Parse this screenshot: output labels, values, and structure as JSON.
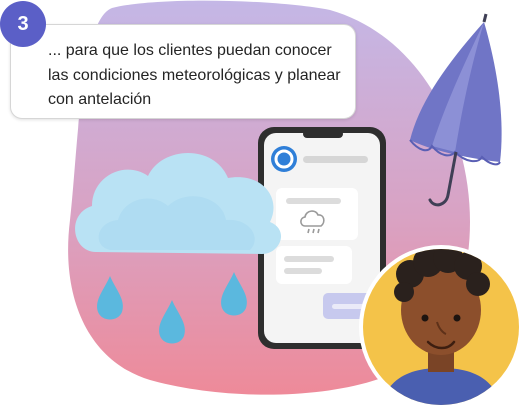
{
  "step": {
    "number": "3",
    "text": "... para que los clientes puedan conocer las condiciones meteorológicas y planear con antelación"
  },
  "colors": {
    "badge": "#5b5fc7",
    "blob_top": "#c4b7e6",
    "blob_bottom": "#ed8c9a",
    "umbrella": "#7075c6",
    "cloud": "#b9e2f4",
    "rain": "#5bb8de",
    "avatar_bg": "#f4c349",
    "phone_frame": "#2e2e2e",
    "phone_button": "#c7c9ee"
  },
  "icons": [
    "rain-cloud-icon",
    "raindrop-icon",
    "umbrella-icon",
    "app-logo-icon",
    "weather-icon",
    "person-avatar"
  ]
}
